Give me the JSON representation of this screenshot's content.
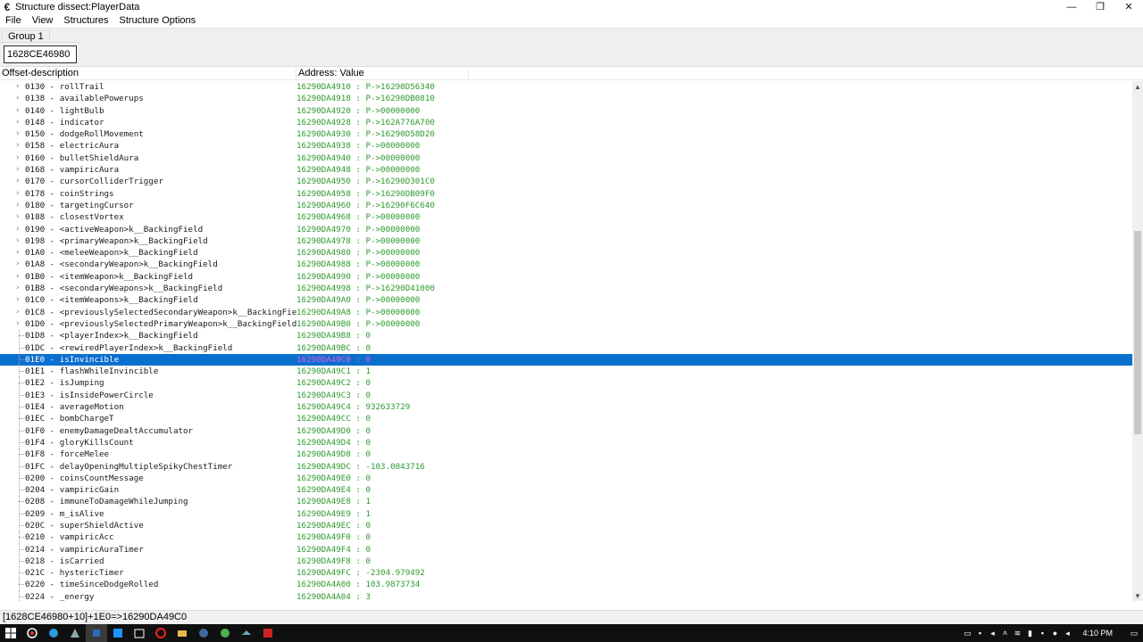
{
  "window": {
    "title": "Structure dissect:PlayerData",
    "minimize": "—",
    "restore": "❐",
    "close": "✕"
  },
  "menu": [
    "File",
    "View",
    "Structures",
    "Structure Options"
  ],
  "group": {
    "tab_label": "Group 1",
    "address": "1628CE46980"
  },
  "columns": {
    "offset_description": "Offset-description",
    "address_value": "Address: Value"
  },
  "rows": [
    {
      "desc": "0130 - rollTrail",
      "val": "16290DA4910 : P->16290D56340",
      "expandable": true
    },
    {
      "desc": "0138 - availablePowerups",
      "val": "16290DA4918 : P->16290DB0810",
      "expandable": true
    },
    {
      "desc": "0140 - lightBulb",
      "val": "16290DA4920 : P->00000000",
      "expandable": true
    },
    {
      "desc": "0148 - indicator",
      "val": "16290DA4928 : P->162A776A700",
      "expandable": true
    },
    {
      "desc": "0150 - dodgeRollMovement",
      "val": "16290DA4930 : P->16290D58D20",
      "expandable": true
    },
    {
      "desc": "0158 - electricAura",
      "val": "16290DA4938 : P->00000000",
      "expandable": true
    },
    {
      "desc": "0160 - bulletShieldAura",
      "val": "16290DA4940 : P->00000000",
      "expandable": true
    },
    {
      "desc": "0168 - vampiricAura",
      "val": "16290DA4948 : P->00000000",
      "expandable": true
    },
    {
      "desc": "0170 - cursorColliderTrigger",
      "val": "16290DA4950 : P->16290D301C0",
      "expandable": true
    },
    {
      "desc": "0178 - coinStrings",
      "val": "16290DA4958 : P->16290DB09F0",
      "expandable": true
    },
    {
      "desc": "0180 - targetingCursor",
      "val": "16290DA4960 : P->16290F6C640",
      "expandable": true
    },
    {
      "desc": "0188 - closestVortex",
      "val": "16290DA4968 : P->00000000",
      "expandable": true
    },
    {
      "desc": "0190 - <activeWeapon>k__BackingField",
      "val": "16290DA4970 : P->00000000",
      "expandable": true
    },
    {
      "desc": "0198 - <primaryWeapon>k__BackingField",
      "val": "16290DA4978 : P->00000000",
      "expandable": true
    },
    {
      "desc": "01A0 - <meleeWeapon>k__BackingField",
      "val": "16290DA4980 : P->00000000",
      "expandable": true
    },
    {
      "desc": "01A8 - <secondaryWeapon>k__BackingField",
      "val": "16290DA4988 : P->00000000",
      "expandable": true
    },
    {
      "desc": "01B0 - <itemWeapon>k__BackingField",
      "val": "16290DA4990 : P->00000000",
      "expandable": true
    },
    {
      "desc": "01B8 - <secondaryWeapons>k__BackingField",
      "val": "16290DA4998 : P->16290D41000",
      "expandable": true
    },
    {
      "desc": "01C0 - <itemWeapons>k__BackingField",
      "val": "16290DA49A0 : P->00000000",
      "expandable": true
    },
    {
      "desc": "01C8 - <previouslySelectedSecondaryWeapon>k__BackingField",
      "val": "16290DA49A8 : P->00000000",
      "expandable": true
    },
    {
      "desc": "01D0 - <previouslySelectedPrimaryWeapon>k__BackingField",
      "val": "16290DA49B0 : P->00000000",
      "expandable": true
    },
    {
      "desc": "01D8 - <playerIndex>k__BackingField",
      "val": "16290DA49B8 : 0",
      "expandable": false
    },
    {
      "desc": "01DC - <rewiredPlayerIndex>k__BackingField",
      "val": "16290DA49BC : 0",
      "expandable": false
    },
    {
      "desc": "01E0 - isInvincible",
      "val": "16290DA49C0 : 0",
      "expandable": false,
      "selected": true
    },
    {
      "desc": "01E1 - flashWhileInvincible",
      "val": "16290DA49C1 : 1",
      "expandable": false
    },
    {
      "desc": "01E2 - isJumping",
      "val": "16290DA49C2 : 0",
      "expandable": false
    },
    {
      "desc": "01E3 - isInsidePowerCircle",
      "val": "16290DA49C3 : 0",
      "expandable": false
    },
    {
      "desc": "01E4 - averageMotion",
      "val": "16290DA49C4 : 932633729",
      "expandable": false
    },
    {
      "desc": "01EC - bombChargeT",
      "val": "16290DA49CC : 0",
      "expandable": false
    },
    {
      "desc": "01F0 - enemyDamageDealtAccumulator",
      "val": "16290DA49D0 : 0",
      "expandable": false
    },
    {
      "desc": "01F4 - gloryKillsCount",
      "val": "16290DA49D4 : 0",
      "expandable": false
    },
    {
      "desc": "01F8 - forceMelee",
      "val": "16290DA49D8 : 0",
      "expandable": false
    },
    {
      "desc": "01FC - delayOpeningMultipleSpikyChestTimer",
      "val": "16290DA49DC : -103.0043716",
      "expandable": false
    },
    {
      "desc": "0200 - coinsCountMessage",
      "val": "16290DA49E0 : 0",
      "expandable": false
    },
    {
      "desc": "0204 - vampiricGain",
      "val": "16290DA49E4 : 0",
      "expandable": false
    },
    {
      "desc": "0208 - immuneToDamageWhileJumping",
      "val": "16290DA49E8 : 1",
      "expandable": false
    },
    {
      "desc": "0209 - m_isAlive",
      "val": "16290DA49E9 : 1",
      "expandable": false
    },
    {
      "desc": "020C - superShieldActive",
      "val": "16290DA49EC : 0",
      "expandable": false
    },
    {
      "desc": "0210 - vampiricAcc",
      "val": "16290DA49F0 : 0",
      "expandable": false
    },
    {
      "desc": "0214 - vampiricAuraTimer",
      "val": "16290DA49F4 : 0",
      "expandable": false
    },
    {
      "desc": "0218 - isCarried",
      "val": "16290DA49F8 : 0",
      "expandable": false
    },
    {
      "desc": "021C - hystericTimer",
      "val": "16290DA49FC : -2304.979492",
      "expandable": false
    },
    {
      "desc": "0220 - timeSinceDodgeRolled",
      "val": "16290DA4A00 : 103.9873734",
      "expandable": false
    },
    {
      "desc": "0224 - _energy",
      "val": "16290DA4A04 : 3",
      "expandable": false
    }
  ],
  "status": "[1628CE46980+10]+1E0=>16290DA49C0",
  "taskbar": {
    "clock": "4:10 PM"
  }
}
